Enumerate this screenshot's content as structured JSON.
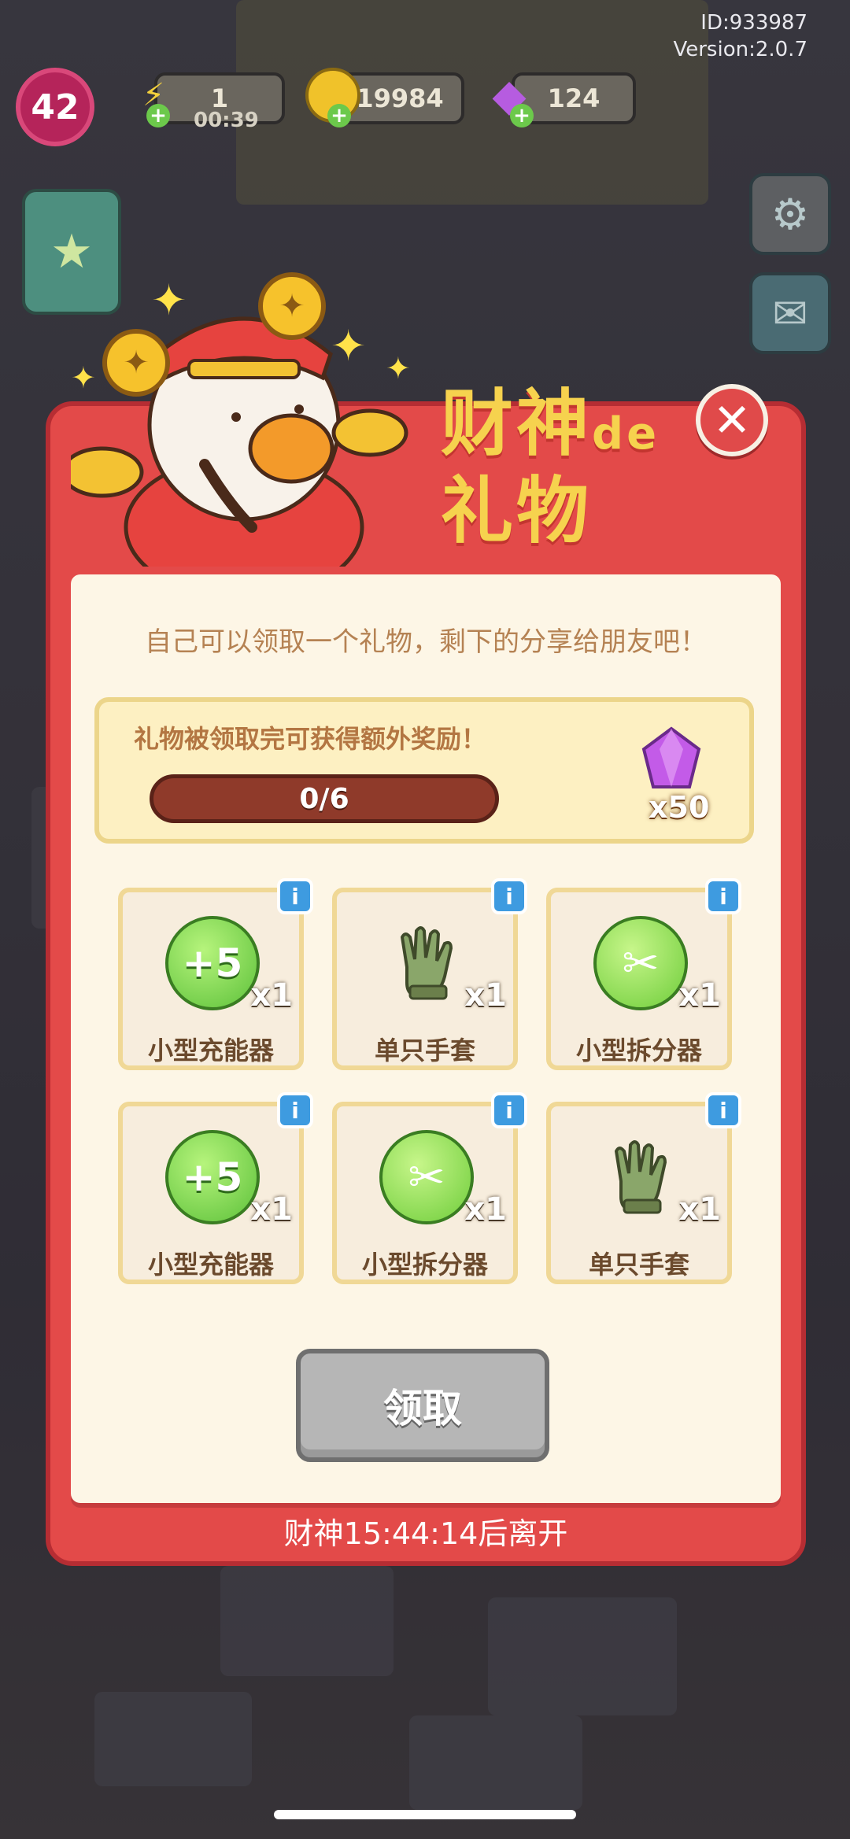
{
  "hud": {
    "user_id": "ID:933987",
    "version": "Version:2.0.7",
    "level": "42",
    "energy": "1",
    "energy_timer": "00:39",
    "coins": "19984",
    "gems": "124"
  },
  "modal": {
    "title_line1": "财神",
    "title_de": "de",
    "title_line2": "礼物",
    "intro": "自己可以领取一个礼物，剩下的分享给朋友吧！",
    "bonus_text": "礼物被领取完可获得额外奖励！",
    "progress_label": "0/6",
    "progress_value": 0,
    "progress_max": 6,
    "bonus_reward": "x50",
    "claim_label": "领取",
    "leave_text": "财神15:44:14后离开"
  },
  "gifts": [
    {
      "name": "小型充能器",
      "qty": "x1",
      "icon": "charger-icon",
      "icon_text": "+5"
    },
    {
      "name": "单只手套",
      "qty": "x1",
      "icon": "glove-icon",
      "icon_text": ""
    },
    {
      "name": "小型拆分器",
      "qty": "x1",
      "icon": "scissors-icon",
      "icon_text": "✂"
    },
    {
      "name": "小型充能器",
      "qty": "x1",
      "icon": "charger-icon",
      "icon_text": "+5"
    },
    {
      "name": "小型拆分器",
      "qty": "x1",
      "icon": "scissors-icon",
      "icon_text": "✂"
    },
    {
      "name": "单只手套",
      "qty": "x1",
      "icon": "glove-icon",
      "icon_text": ""
    }
  ],
  "colors": {
    "modal_red": "#e34a49",
    "paper": "#fdf6e6",
    "title_gold": "#f6d24e",
    "info_blue": "#3e9be0"
  }
}
